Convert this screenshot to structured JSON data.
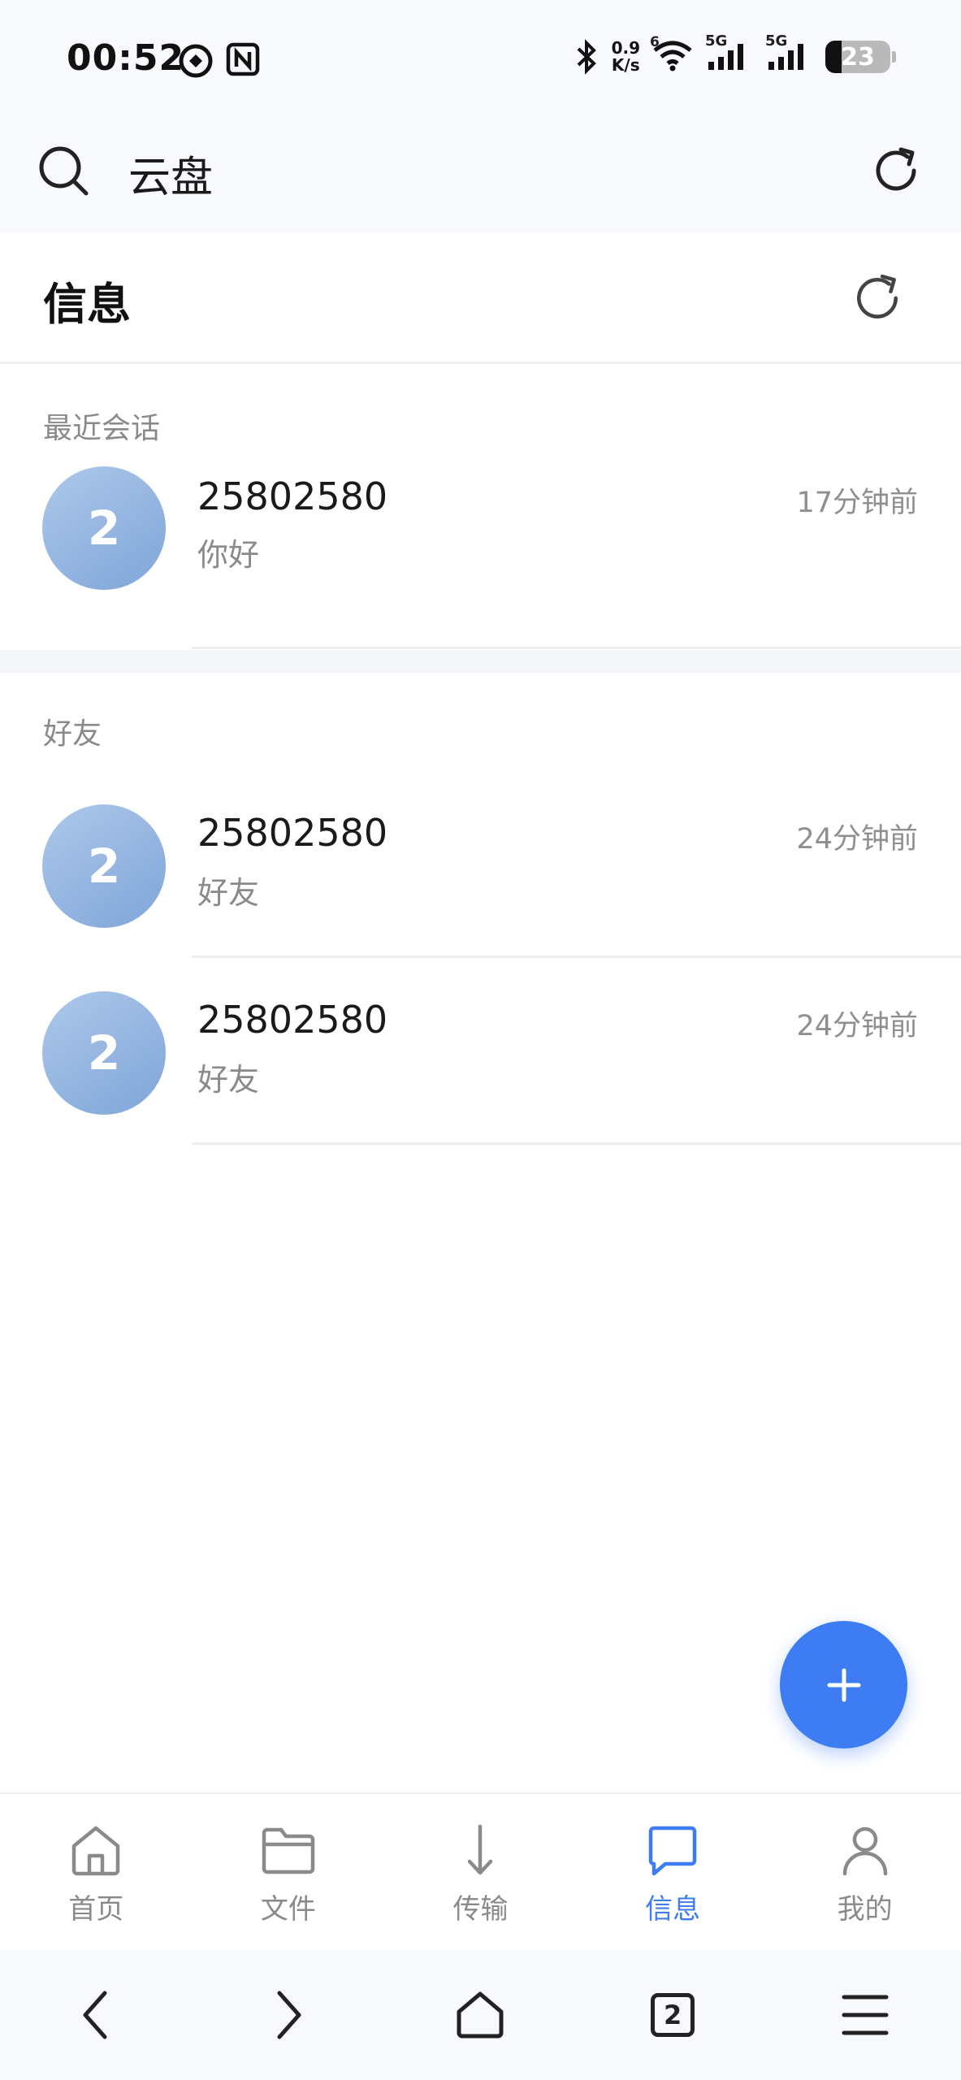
{
  "status_bar": {
    "time": "00:52",
    "net_speed_value": "0.9",
    "net_speed_unit": "K/s",
    "wifi_label": "6",
    "sim1_label": "5G",
    "sim2_label": "5G",
    "battery_level": "23"
  },
  "app_header": {
    "title": "云盘"
  },
  "page": {
    "title": "信息"
  },
  "recent": {
    "label": "最近会话",
    "items": [
      {
        "avatar": "2",
        "name": "25802580",
        "message": "你好",
        "time": "17分钟前"
      }
    ]
  },
  "friends": {
    "label": "好友",
    "items": [
      {
        "avatar": "2",
        "name": "25802580",
        "message": "好友",
        "time": "24分钟前"
      },
      {
        "avatar": "2",
        "name": "25802580",
        "message": "好友",
        "time": "24分钟前"
      }
    ]
  },
  "bottom_nav": {
    "items": [
      {
        "label": "首页",
        "icon": "home-icon"
      },
      {
        "label": "文件",
        "icon": "folder-icon"
      },
      {
        "label": "传输",
        "icon": "transfer-arrow-icon"
      },
      {
        "label": "信息",
        "icon": "message-icon",
        "active": true
      },
      {
        "label": "我的",
        "icon": "profile-icon"
      }
    ]
  },
  "system_nav": {
    "tab_count": "2"
  },
  "colors": {
    "accent": "#3d7cf2",
    "avatar_start": "#aec8ea",
    "avatar_end": "#7ea5d9",
    "secondary_text": "#8a8a8a"
  }
}
